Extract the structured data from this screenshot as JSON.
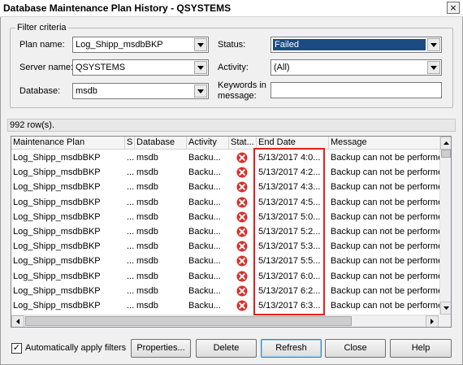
{
  "window": {
    "title": "Database Maintenance Plan History - QSYSTEMS",
    "close_glyph": "×"
  },
  "filter": {
    "legend": "Filter criteria",
    "plan_name": {
      "label": "Plan name:",
      "value": "Log_Shipp_msdbBKP"
    },
    "server_name": {
      "label": "Server name:",
      "value": "QSYSTEMS"
    },
    "database": {
      "label": "Database:",
      "value": "msdb"
    },
    "status": {
      "label": "Status:",
      "value": "Failed"
    },
    "activity": {
      "label": "Activity:",
      "value": "(All)"
    },
    "keywords": {
      "label_line1": "Keywords in",
      "label_line2": "message:",
      "value": ""
    }
  },
  "row_count": "992 row(s).",
  "grid": {
    "columns": [
      "Maintenance Plan",
      "S",
      "Database",
      "Activity",
      "Stat...",
      "End Date",
      "Message"
    ],
    "rows": [
      {
        "plan": "Log_Shipp_msdbBKP",
        "s": "...",
        "database": "msdb",
        "activity": "Backu...",
        "status": "failed-icon",
        "end_date": "5/13/2017 4:0...",
        "message": "Backup can not be performe"
      },
      {
        "plan": "Log_Shipp_msdbBKP",
        "s": "...",
        "database": "msdb",
        "activity": "Backu...",
        "status": "failed-icon",
        "end_date": "5/13/2017 4:2...",
        "message": "Backup can not be performe"
      },
      {
        "plan": "Log_Shipp_msdbBKP",
        "s": "...",
        "database": "msdb",
        "activity": "Backu...",
        "status": "failed-icon",
        "end_date": "5/13/2017 4:3...",
        "message": "Backup can not be performe"
      },
      {
        "plan": "Log_Shipp_msdbBKP",
        "s": "...",
        "database": "msdb",
        "activity": "Backu...",
        "status": "failed-icon",
        "end_date": "5/13/2017 4:5...",
        "message": "Backup can not be performe"
      },
      {
        "plan": "Log_Shipp_msdbBKP",
        "s": "...",
        "database": "msdb",
        "activity": "Backu...",
        "status": "failed-icon",
        "end_date": "5/13/2017 5:0...",
        "message": "Backup can not be performe"
      },
      {
        "plan": "Log_Shipp_msdbBKP",
        "s": "...",
        "database": "msdb",
        "activity": "Backu...",
        "status": "failed-icon",
        "end_date": "5/13/2017 5:2...",
        "message": "Backup can not be performe"
      },
      {
        "plan": "Log_Shipp_msdbBKP",
        "s": "...",
        "database": "msdb",
        "activity": "Backu...",
        "status": "failed-icon",
        "end_date": "5/13/2017 5:3...",
        "message": "Backup can not be performe"
      },
      {
        "plan": "Log_Shipp_msdbBKP",
        "s": "...",
        "database": "msdb",
        "activity": "Backu...",
        "status": "failed-icon",
        "end_date": "5/13/2017 5:5...",
        "message": "Backup can not be performe"
      },
      {
        "plan": "Log_Shipp_msdbBKP",
        "s": "...",
        "database": "msdb",
        "activity": "Backu...",
        "status": "failed-icon",
        "end_date": "5/13/2017 6:0...",
        "message": "Backup can not be performe"
      },
      {
        "plan": "Log_Shipp_msdbBKP",
        "s": "...",
        "database": "msdb",
        "activity": "Backu...",
        "status": "failed-icon",
        "end_date": "5/13/2017 6:2...",
        "message": "Backup can not be performe"
      },
      {
        "plan": "Log_Shipp_msdbBKP",
        "s": "...",
        "database": "msdb",
        "activity": "Backu...",
        "status": "failed-icon",
        "end_date": "5/13/2017 6:3...",
        "message": "Backup can not be performe"
      }
    ]
  },
  "auto_apply": {
    "label": "Automatically apply filters",
    "checked": true,
    "check_glyph": "✓"
  },
  "buttons": {
    "properties": "Properties...",
    "delete": "Delete",
    "refresh": "Refresh",
    "close": "Close",
    "help": "Help"
  },
  "colors": {
    "selection": "#1c4a82",
    "highlight_box": "#e02020",
    "failed_icon": "#d9302a"
  }
}
